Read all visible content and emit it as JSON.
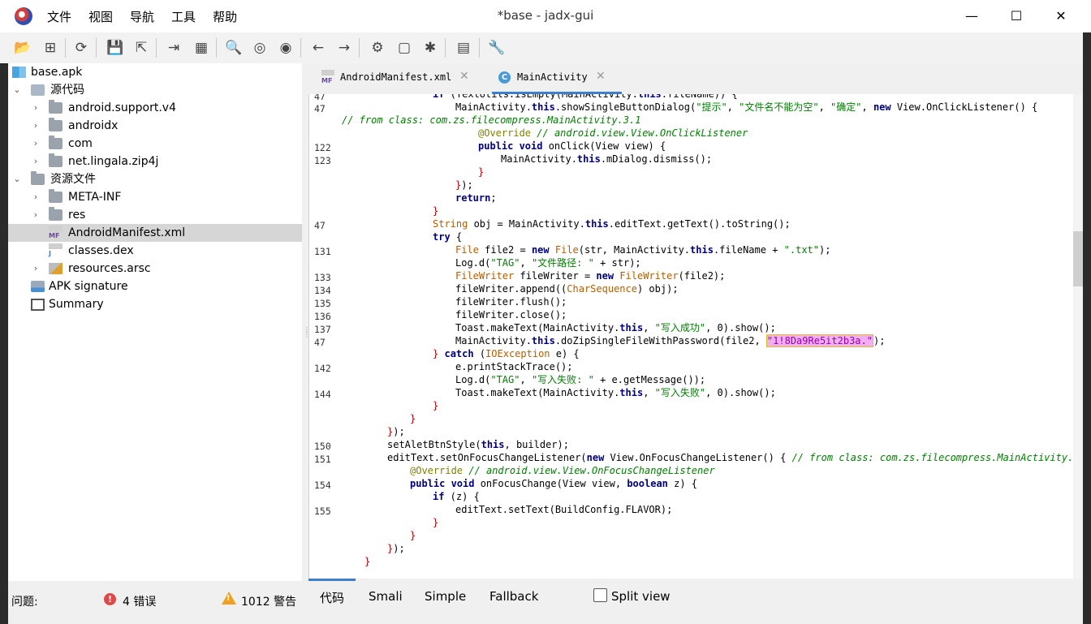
{
  "window": {
    "title": "*base - jadx-gui"
  },
  "menu": [
    "文件",
    "视图",
    "导航",
    "工具",
    "帮助"
  ],
  "tree": {
    "items": [
      {
        "label": "base.apk",
        "icon": "apk-icon"
      },
      {
        "label": "源代码",
        "icon": "package-icon"
      },
      {
        "label": "android.support.v4",
        "icon": "folder-icon"
      },
      {
        "label": "androidx",
        "icon": "folder-icon"
      },
      {
        "label": "com",
        "icon": "folder-icon"
      },
      {
        "label": "net.lingala.zip4j",
        "icon": "folder-icon"
      },
      {
        "label": "资源文件",
        "icon": "folder-icon"
      },
      {
        "label": "META-INF",
        "icon": "folder-icon"
      },
      {
        "label": "res",
        "icon": "folder-icon"
      },
      {
        "label": "AndroidManifest.xml",
        "icon": "manifest-icon",
        "badge": "MF"
      },
      {
        "label": "classes.dex",
        "icon": "dex-icon",
        "badge": "J"
      },
      {
        "label": "resources.arsc",
        "icon": "arsc-icon"
      },
      {
        "label": "APK signature",
        "icon": "signature-icon"
      },
      {
        "label": "Summary",
        "icon": "summary-icon"
      }
    ]
  },
  "tabs": [
    {
      "label": "AndroidManifest.xml",
      "badge": "MF"
    },
    {
      "label": "MainActivity",
      "badge": "C"
    }
  ],
  "code": {
    "highlight": "1!8Da9Re5it2b3a."
  },
  "bottom_tabs": {
    "code": "代码",
    "smali": "Smali",
    "simple": "Simple",
    "fallback": "Fallback",
    "split": "Split view"
  },
  "status": {
    "label": "问题:",
    "errors": "4 错误",
    "warnings": "1012 警告"
  }
}
